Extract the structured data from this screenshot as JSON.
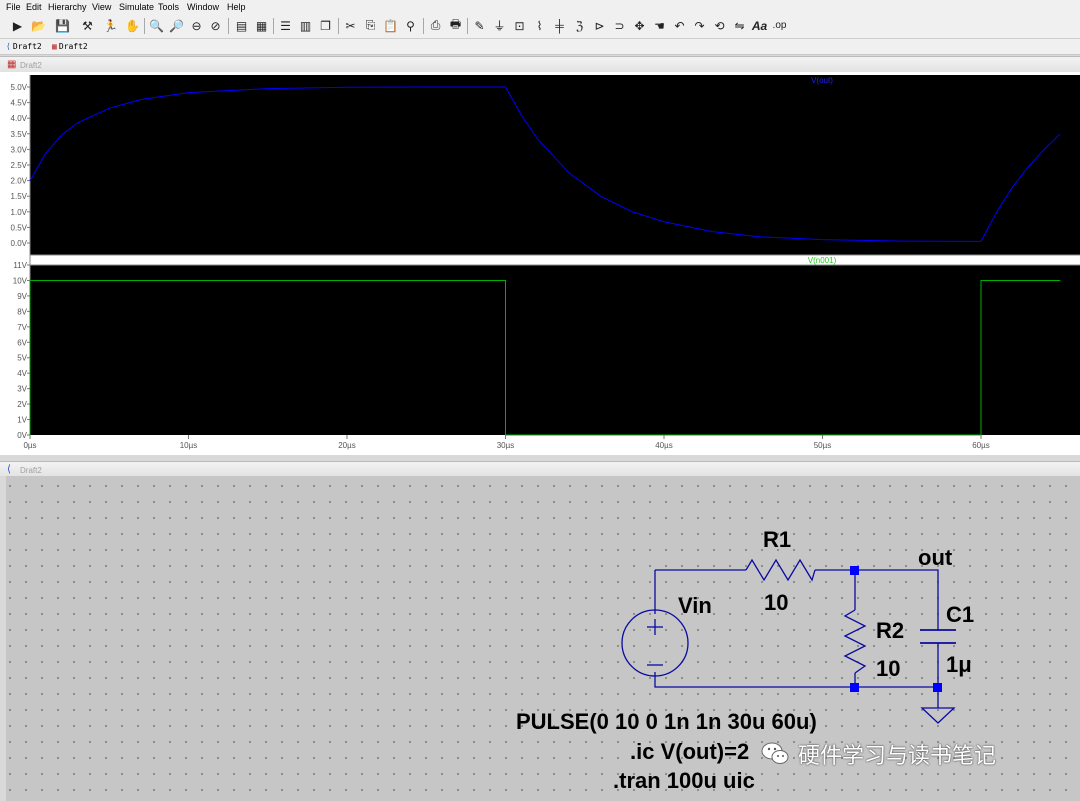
{
  "menu": [
    "File",
    "Edit",
    "Hierarchy",
    "View",
    "Simulate",
    "Tools",
    "Window",
    "Help"
  ],
  "toolbar_icons": [
    "new-schematic",
    "open",
    "save",
    "control-panel",
    "run",
    "pan",
    "zoom-in",
    "zoom-area",
    "zoom-out",
    "zoom-cancel",
    "autorange",
    "fit",
    "tile-horizontal",
    "tile-vertical",
    "cascade",
    "cut",
    "copy",
    "find",
    "print",
    "print-setup",
    "draw-wire",
    "ground",
    "label-net",
    "resistor",
    "capacitor",
    "inductor",
    "diode",
    "component",
    "move",
    "drag",
    "undo",
    "redo",
    "rotate",
    "mirror",
    "text",
    "spice-directive"
  ],
  "toolbar_text": {
    "text_tool": "Aa",
    "spice_tool": ".op"
  },
  "tabs": [
    {
      "label": "Draft2",
      "icon": "schematic-tab-icon"
    },
    {
      "label": "Draft2",
      "icon": "waveform-tab-icon"
    }
  ],
  "waveform_window": {
    "title": "Draft2"
  },
  "schematic_window": {
    "title": "Draft2"
  },
  "chart_data": [
    {
      "type": "line",
      "series": [
        {
          "name": "V(out)",
          "color": "#0000ff",
          "x": [
            0,
            1,
            2,
            3,
            5,
            7,
            10,
            15,
            20,
            25,
            29,
            30,
            31,
            32,
            34,
            36,
            38,
            40,
            43,
            46,
            50,
            55,
            59.5,
            60,
            61,
            62,
            63,
            64,
            65
          ],
          "y": [
            2.0,
            2.88,
            3.46,
            3.85,
            4.32,
            4.6,
            4.82,
            4.95,
            4.99,
            5.0,
            5.0,
            5.0,
            4.1,
            3.35,
            2.25,
            1.5,
            1.0,
            0.68,
            0.37,
            0.2,
            0.11,
            0.06,
            0.05,
            0.05,
            1.0,
            1.8,
            2.45,
            3.0,
            3.5
          ]
        }
      ],
      "xlim": [
        0,
        65
      ],
      "ylim": [
        0,
        5
      ],
      "yticks": [
        "0.0V",
        "0.5V",
        "1.0V",
        "1.5V",
        "2.0V",
        "2.5V",
        "3.0V",
        "3.5V",
        "4.0V",
        "4.5V",
        "5.0V"
      ],
      "ytick_values": [
        0,
        0.5,
        1,
        1.5,
        2,
        2.5,
        3,
        3.5,
        4,
        4.5,
        5
      ],
      "grid": false
    },
    {
      "type": "line",
      "series": [
        {
          "name": "V(n001)",
          "color": "#00b000",
          "x": [
            0,
            0,
            30,
            30,
            60,
            60,
            65
          ],
          "y": [
            0,
            10,
            10,
            0,
            0,
            10,
            10
          ]
        }
      ],
      "xlim": [
        0,
        65
      ],
      "ylim": [
        0,
        11
      ],
      "yticks": [
        "0V",
        "1V",
        "2V",
        "3V",
        "4V",
        "5V",
        "6V",
        "7V",
        "8V",
        "9V",
        "10V",
        "11V"
      ],
      "ytick_values": [
        0,
        1,
        2,
        3,
        4,
        5,
        6,
        7,
        8,
        9,
        10,
        11
      ],
      "xticks": [
        "0µs",
        "10µs",
        "20µs",
        "30µs",
        "40µs",
        "50µs",
        "60µs"
      ],
      "xtick_values": [
        0,
        10,
        20,
        30,
        40,
        50,
        60
      ],
      "grid": false
    }
  ],
  "schematic": {
    "components": {
      "R1": {
        "name": "R1",
        "value": "10"
      },
      "R2": {
        "name": "R2",
        "value": "10"
      },
      "C1": {
        "name": "C1",
        "value": "1μ"
      },
      "Vin": {
        "name": "Vin"
      }
    },
    "net_label": "out",
    "directives": {
      "pulse": "PULSE(0 10 0 1n 1n 30u 60u)",
      "ic": ".ic V(out)=2",
      "tran": ".tran 100u uic"
    }
  },
  "watermark": {
    "text": "硬件学习与读书笔记"
  }
}
